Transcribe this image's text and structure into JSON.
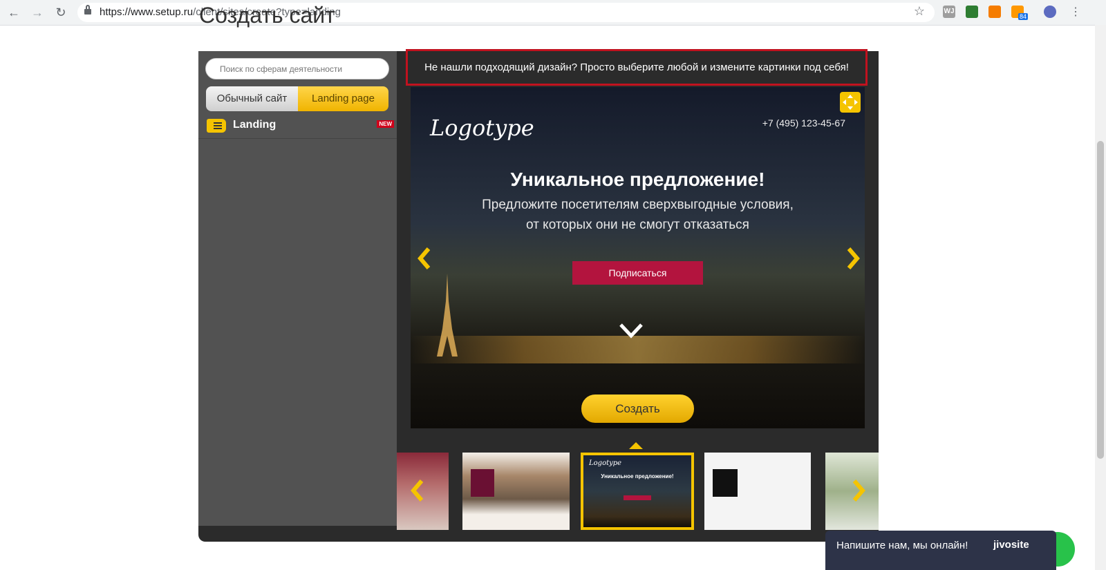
{
  "browser": {
    "url_host": "https://www.setup.ru",
    "url_path": "/client/sites/create?type=landing",
    "rss_badge": "84",
    "ext_wj": "WJ"
  },
  "page": {
    "title": "Создать сайт"
  },
  "sidebar": {
    "search_placeholder": "Поиск по сферам деятельности",
    "tab_regular": "Обычный сайт",
    "tab_landing": "Landing page",
    "category_label": "Landing",
    "new_badge": "NEW"
  },
  "notice": "Не нашли подходящий дизайн? Просто выберите любой и измените картинки под себя!",
  "preview": {
    "logo": "Logotype",
    "phone": "+7 (495) 123-45-67",
    "headline": "Уникальное предложение!",
    "subline_1": "Предложите посетителям сверхвыгодные условия,",
    "subline_2": "от которых они не смогут отказаться",
    "subscribe": "Подписаться"
  },
  "create_button": "Создать",
  "thumbnails": {
    "active_headline": "Уникальное предложение!",
    "logo_small": "Logotype"
  },
  "jivo": {
    "text": "Напишите нам, мы онлайн!",
    "brand": "jivosite"
  },
  "colors": {
    "accent_yellow": "#f5c400",
    "notice_border": "#c1121f",
    "subscribe_red": "#b3143e",
    "sidebar_gray": "#525252",
    "frame_dark": "#2b2b2b"
  }
}
